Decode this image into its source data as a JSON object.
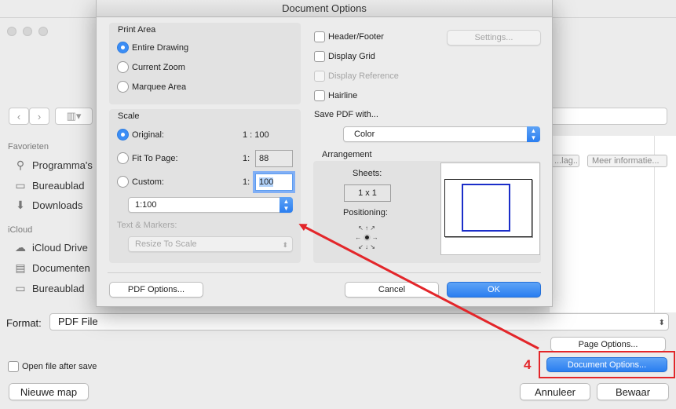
{
  "dialog": {
    "title": "Document Options",
    "print_area": {
      "label": "Print Area",
      "options": [
        "Entire Drawing",
        "Current Zoom",
        "Marquee Area"
      ],
      "selected": "Entire Drawing"
    },
    "scale": {
      "label": "Scale",
      "original_label": "Original:",
      "original_value": "1 : 100",
      "fit_label": "Fit To Page:",
      "fit_prefix": "1:",
      "fit_value": "88",
      "custom_label": "Custom:",
      "custom_prefix": "1:",
      "custom_value": "100",
      "scale_select": "1:100",
      "selected": "Original:"
    },
    "text_markers": {
      "label": "Text & Markers:",
      "select": "Resize To Scale"
    },
    "checks": {
      "header_footer": "Header/Footer",
      "settings_button": "Settings...",
      "display_grid": "Display Grid",
      "display_reference": "Display Reference",
      "hairline": "Hairline"
    },
    "save_pdf": {
      "label": "Save PDF with...",
      "value": "Color"
    },
    "arrangement": {
      "label": "Arrangement",
      "sheets_label": "Sheets:",
      "sheets_value": "1 x 1",
      "positioning_label": "Positioning:"
    },
    "buttons": {
      "pdf_options": "PDF Options...",
      "cancel": "Cancel",
      "ok": "OK"
    }
  },
  "save_window": {
    "sidebar": {
      "favorites_head": "Favorieten",
      "favorites": [
        {
          "label": "Programma's",
          "icon": "applications-icon"
        },
        {
          "label": "Bureaublad",
          "icon": "desktop-icon"
        },
        {
          "label": "Downloads",
          "icon": "downloads-icon"
        }
      ],
      "icloud_head": "iCloud",
      "icloud": [
        {
          "label": "iCloud Drive",
          "icon": "cloud-icon"
        },
        {
          "label": "Documenten",
          "icon": "document-icon"
        },
        {
          "label": "Bureaublad",
          "icon": "desktop-icon"
        }
      ]
    },
    "tags": [
      "...lag...",
      "Meer informatie..."
    ],
    "format_label": "Format:",
    "format_value": "PDF File",
    "page_options": "Page Options...",
    "open_after_save": "Open file after save",
    "document_options": "Document Options...",
    "new_folder": "Nieuwe map",
    "cancel": "Annuleer",
    "save": "Bewaar"
  },
  "annotation": {
    "step_number": "4",
    "color": "#e3262a"
  },
  "colors": {
    "accent": "#2a7ef0",
    "preview_page_border": "#1b2ec9"
  }
}
